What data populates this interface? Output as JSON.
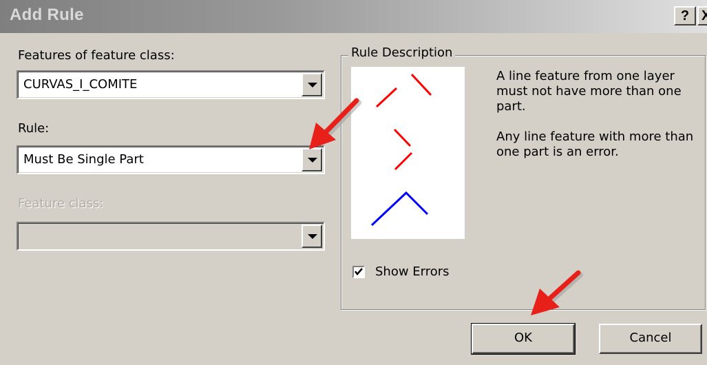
{
  "window": {
    "title": "Add Rule",
    "help_label": "?",
    "close_label": "X"
  },
  "left": {
    "features_label": "Features of feature class:",
    "features_value": "CURVAS_I_COMITE",
    "rule_label": "Rule:",
    "rule_value": "Must Be Single Part",
    "feature_class_label": "Feature class:",
    "feature_class_value": ""
  },
  "rule_description": {
    "title": "Rule Description",
    "paragraphs": [
      "A line feature from one layer must not have more than one part.",
      "Any line feature with more than one part is an error."
    ],
    "colors": {
      "error": "#ff0000",
      "valid": "#0000ff"
    }
  },
  "show_errors": {
    "label": "Show Errors",
    "checked": true
  },
  "buttons": {
    "ok": "OK",
    "cancel": "Cancel"
  },
  "annotations": {
    "arrow_color": "#e8201a"
  }
}
